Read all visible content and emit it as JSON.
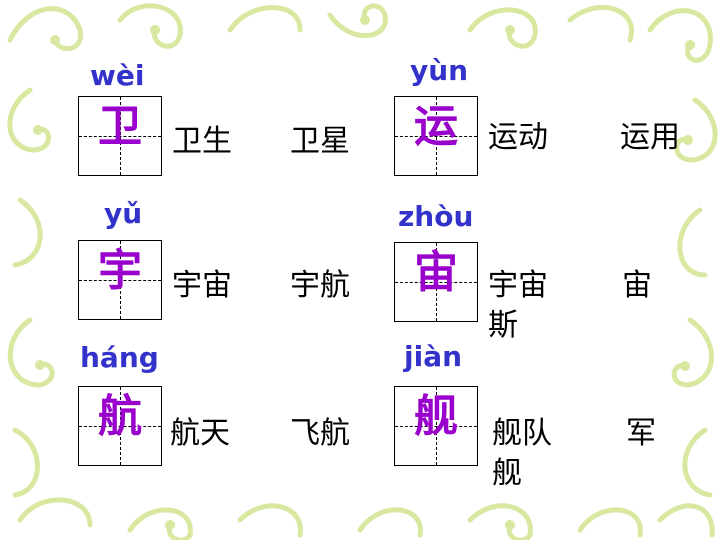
{
  "colors": {
    "pinyin": "#3333cc",
    "character": "#9900cc",
    "word": "#000000",
    "vine": "#d8e8a0"
  },
  "cards": [
    {
      "pinyin": "wèi",
      "character": "卫",
      "words": [
        "卫生",
        "卫星"
      ]
    },
    {
      "pinyin": "yùn",
      "character": "运",
      "words": [
        "运动",
        "运用"
      ]
    },
    {
      "pinyin": "yǔ",
      "character": "宇",
      "words": [
        "宇宙",
        "宇航"
      ]
    },
    {
      "pinyin": "zhòu",
      "character": "宙",
      "words": [
        "宇宙",
        "斯",
        "宙"
      ]
    },
    {
      "pinyin": "háng",
      "character": "航",
      "words": [
        "航天",
        "飞航"
      ]
    },
    {
      "pinyin": "jiàn",
      "character": "舰",
      "words": [
        "舰队",
        "舰",
        "军"
      ]
    }
  ]
}
